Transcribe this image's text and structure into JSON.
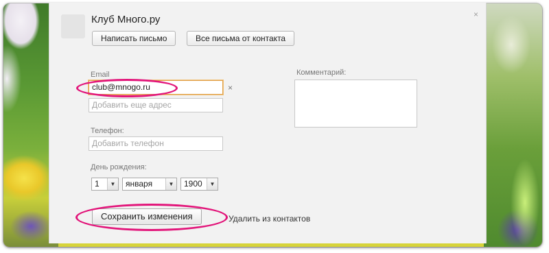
{
  "contact": {
    "name": "Клуб Много.ру",
    "write_button": "Написать письмо",
    "all_letters_button": "Все письма от контакта",
    "close_icon": "×"
  },
  "form": {
    "email_label": "Email",
    "email_value": "club@mnogo.ru",
    "email_clear_icon": "×",
    "add_email_placeholder": "Добавить еще адрес",
    "phone_label": "Телефон:",
    "phone_placeholder": "Добавить телефон",
    "birthday_label": "День рождения:",
    "birthday": {
      "day": "1",
      "month": "января",
      "year": "1900"
    },
    "comment_label": "Комментарий:",
    "save_button": "Сохранить изменения",
    "delete_link": "Удалить из контактов"
  },
  "colors": {
    "highlight_ring": "#e2157a",
    "focus_border": "#e0a04a"
  }
}
